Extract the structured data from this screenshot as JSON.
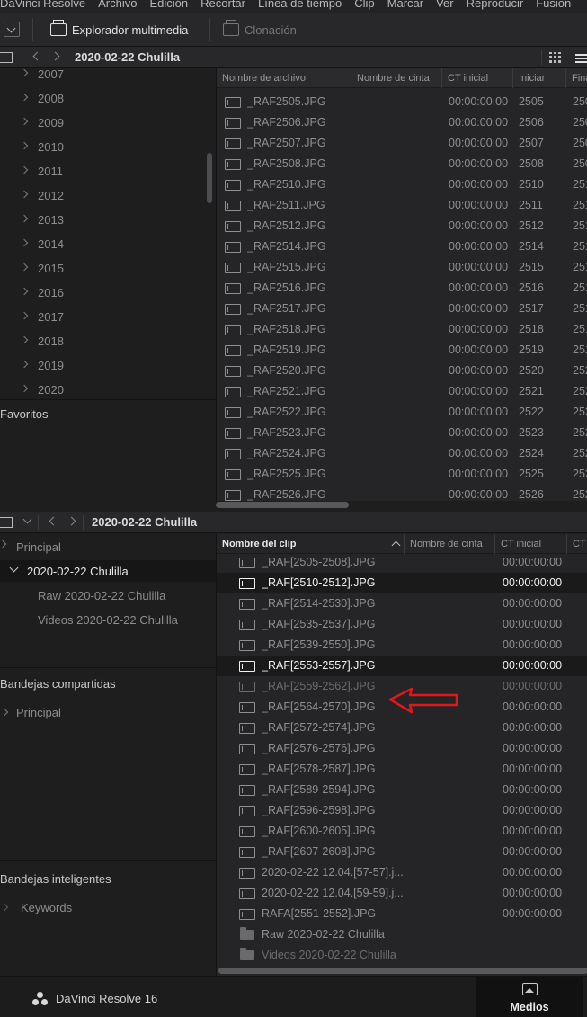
{
  "menu": [
    "DaVinci Resolve",
    "Archivo",
    "Edición",
    "Recortar",
    "Línea de tiempo",
    "Clip",
    "Marcar",
    "Ver",
    "Reproducir",
    "Fusion"
  ],
  "toolbar": {
    "media_browser_label": "Explorador multimedia",
    "clone_label": "Clonación"
  },
  "media_storage": {
    "path_title": "2020-02-22 Chulilla",
    "years": [
      "2007",
      "2008",
      "2009",
      "2010",
      "2011",
      "2012",
      "2013",
      "2014",
      "2015",
      "2016",
      "2017",
      "2018",
      "2019",
      "2020"
    ],
    "favorites_label": "Favoritos",
    "columns": [
      "Nombre de archivo",
      "Nombre de cinta",
      "CT inicial",
      "Iniciar",
      "Fina"
    ],
    "files": [
      {
        "name": "_RAF2505.JPG",
        "tc": "00:00:00:00",
        "start": "2505",
        "end": "250"
      },
      {
        "name": "_RAF2506.JPG",
        "tc": "00:00:00:00",
        "start": "2506",
        "end": "250"
      },
      {
        "name": "_RAF2507.JPG",
        "tc": "00:00:00:00",
        "start": "2507",
        "end": "250"
      },
      {
        "name": "_RAF2508.JPG",
        "tc": "00:00:00:00",
        "start": "2508",
        "end": "250"
      },
      {
        "name": "_RAF2510.JPG",
        "tc": "00:00:00:00",
        "start": "2510",
        "end": "251"
      },
      {
        "name": "_RAF2511.JPG",
        "tc": "00:00:00:00",
        "start": "2511",
        "end": "251"
      },
      {
        "name": "_RAF2512.JPG",
        "tc": "00:00:00:00",
        "start": "2512",
        "end": "251"
      },
      {
        "name": "_RAF2514.JPG",
        "tc": "00:00:00:00",
        "start": "2514",
        "end": "251"
      },
      {
        "name": "_RAF2515.JPG",
        "tc": "00:00:00:00",
        "start": "2515",
        "end": "251"
      },
      {
        "name": "_RAF2516.JPG",
        "tc": "00:00:00:00",
        "start": "2516",
        "end": "251"
      },
      {
        "name": "_RAF2517.JPG",
        "tc": "00:00:00:00",
        "start": "2517",
        "end": "251"
      },
      {
        "name": "_RAF2518.JPG",
        "tc": "00:00:00:00",
        "start": "2518",
        "end": "251"
      },
      {
        "name": "_RAF2519.JPG",
        "tc": "00:00:00:00",
        "start": "2519",
        "end": "251"
      },
      {
        "name": "_RAF2520.JPG",
        "tc": "00:00:00:00",
        "start": "2520",
        "end": "252"
      },
      {
        "name": "_RAF2521.JPG",
        "tc": "00:00:00:00",
        "start": "2521",
        "end": "252"
      },
      {
        "name": "_RAF2522.JPG",
        "tc": "00:00:00:00",
        "start": "2522",
        "end": "252"
      },
      {
        "name": "_RAF2523.JPG",
        "tc": "00:00:00:00",
        "start": "2523",
        "end": "252"
      },
      {
        "name": "_RAF2524.JPG",
        "tc": "00:00:00:00",
        "start": "2524",
        "end": "252"
      },
      {
        "name": "_RAF2525.JPG",
        "tc": "00:00:00:00",
        "start": "2525",
        "end": "252"
      },
      {
        "name": "_RAF2526.JPG",
        "tc": "00:00:00:00",
        "start": "2526",
        "end": "252"
      }
    ]
  },
  "media_pool": {
    "bin_title": "2020-02-22 Chulilla",
    "bins": {
      "principal_label": "Principal",
      "current_bin": "2020-02-22 Chulilla",
      "sub_bins": [
        "Raw 2020-02-22 Chulilla",
        "Videos 2020-02-22 Chulilla"
      ],
      "shared_label": "Bandejas compartidas",
      "shared_principal": "Principal",
      "smart_label": "Bandejas inteligentes",
      "keywords_label": "Keywords"
    },
    "columns": [
      "Nombre del clip",
      "Nombre de cinta",
      "CT inicial",
      "CT"
    ],
    "clips": [
      {
        "name": "_RAF[2505-2508].JPG",
        "tc": "00:00:00:00",
        "state": "normal",
        "icon": "clip"
      },
      {
        "name": "_RAF[2510-2512].JPG",
        "tc": "00:00:00:00",
        "state": "selected",
        "icon": "clip"
      },
      {
        "name": "_RAF[2514-2530].JPG",
        "tc": "00:00:00:00",
        "state": "normal",
        "icon": "clip"
      },
      {
        "name": "_RAF[2535-2537].JPG",
        "tc": "00:00:00:00",
        "state": "normal",
        "icon": "clip"
      },
      {
        "name": "_RAF[2539-2550].JPG",
        "tc": "00:00:00:00",
        "state": "normal",
        "icon": "clip"
      },
      {
        "name": "_RAF[2553-2557].JPG",
        "tc": "00:00:00:00",
        "state": "selected",
        "icon": "clip"
      },
      {
        "name": "_RAF[2559-2562].JPG",
        "tc": "00:00:00:00",
        "state": "dim",
        "icon": "clip"
      },
      {
        "name": "_RAF[2564-2570].JPG",
        "tc": "00:00:00:00",
        "state": "normal",
        "icon": "clip"
      },
      {
        "name": "_RAF[2572-2574].JPG",
        "tc": "00:00:00:00",
        "state": "normal",
        "icon": "clip"
      },
      {
        "name": "_RAF[2576-2576].JPG",
        "tc": "00:00:00:00",
        "state": "normal",
        "icon": "clip"
      },
      {
        "name": "_RAF[2578-2587].JPG",
        "tc": "00:00:00:00",
        "state": "normal",
        "icon": "clip"
      },
      {
        "name": "_RAF[2589-2594].JPG",
        "tc": "00:00:00:00",
        "state": "normal",
        "icon": "clip"
      },
      {
        "name": "_RAF[2596-2598].JPG",
        "tc": "00:00:00:00",
        "state": "normal",
        "icon": "clip"
      },
      {
        "name": "_RAF[2600-2605].JPG",
        "tc": "00:00:00:00",
        "state": "normal",
        "icon": "clip"
      },
      {
        "name": "_RAF[2607-2608].JPG",
        "tc": "00:00:00:00",
        "state": "normal",
        "icon": "clip"
      },
      {
        "name": "2020-02-22 12.04.[57-57].j...",
        "tc": "00:00:00:00",
        "state": "normal",
        "icon": "clip"
      },
      {
        "name": "2020-02-22 12.04.[59-59].j...",
        "tc": "00:00:00:00",
        "state": "normal",
        "icon": "clip"
      },
      {
        "name": "RAFA[2551-2552].JPG",
        "tc": "00:00:00:00",
        "state": "normal",
        "icon": "clip"
      },
      {
        "name": "Raw 2020-02-22 Chulilla",
        "tc": "",
        "state": "normal",
        "icon": "folder"
      },
      {
        "name": "Videos 2020-02-22 Chulilla",
        "tc": "",
        "state": "dim",
        "icon": "folder"
      }
    ]
  },
  "annotation": {
    "arrow_color": "#e0181c",
    "icon": "red-arrow-icon"
  },
  "bottom": {
    "app_name": "DaVinci Resolve 16",
    "media_tab_label": "Medios"
  }
}
